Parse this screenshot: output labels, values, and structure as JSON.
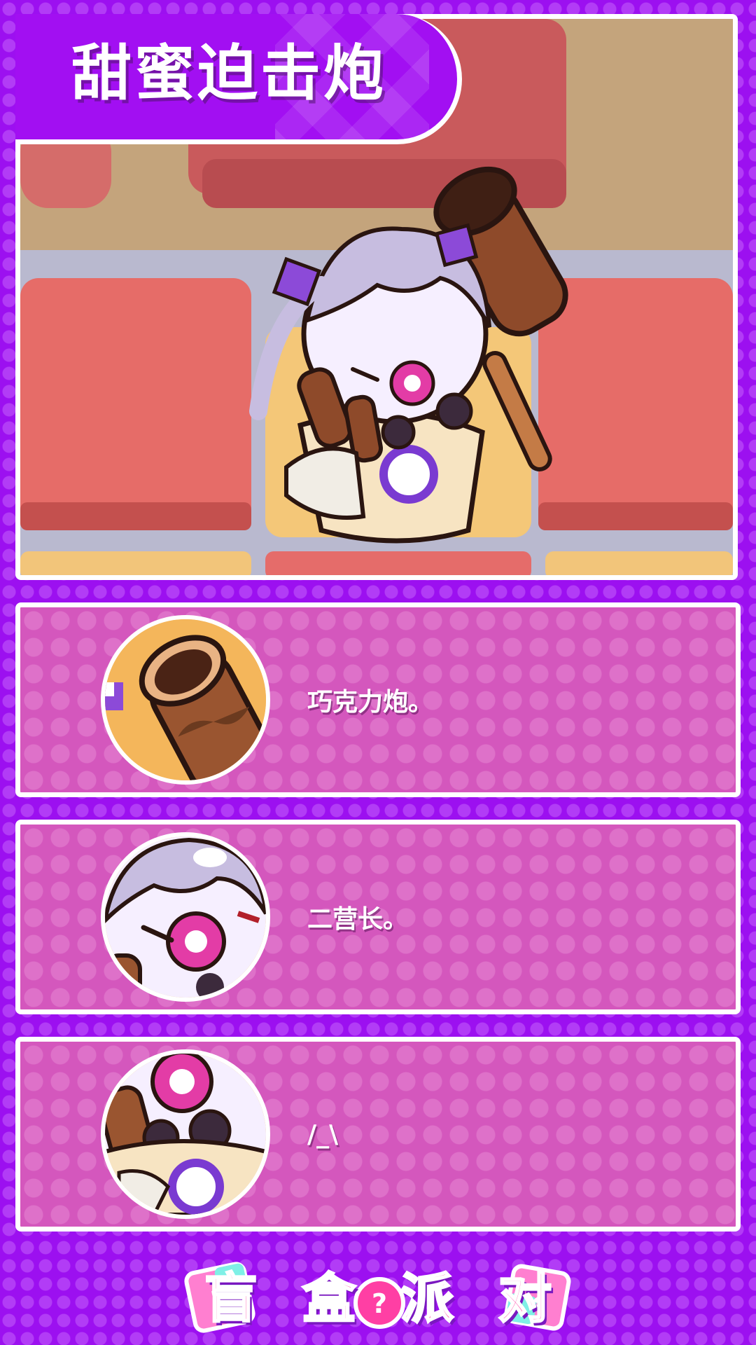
{
  "hero": {
    "title": "甜蜜迫击炮"
  },
  "skills": [
    {
      "icon": "chocolate-cannon-icon",
      "text": "巧克力炮。"
    },
    {
      "icon": "character-face-icon",
      "text": "二营长。"
    },
    {
      "icon": "character-body-icon",
      "text": "/_\\"
    }
  ],
  "logo": {
    "text": "盲盒派对",
    "icon": "mystery-box-icon"
  },
  "colors": {
    "background": "#9c10f0",
    "banner": "#a20ff2",
    "card": "#d457bd",
    "border": "#ffffff",
    "logo_pink": "#ff3fa4",
    "logo_cyan": "#7ff0e6"
  }
}
